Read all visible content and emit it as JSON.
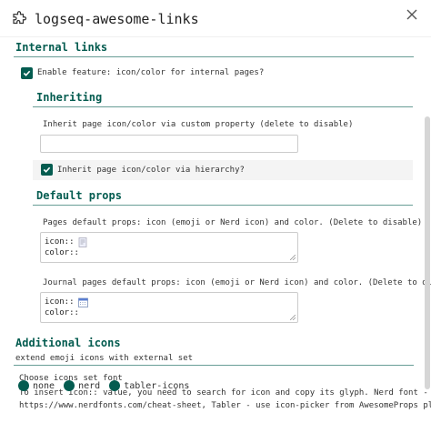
{
  "header": {
    "title": "logseq-awesome-links"
  },
  "internal_links": {
    "title": "Internal links",
    "enable_label": "Enable feature: icon/color for internal pages?",
    "enable_checked": true,
    "inheriting": {
      "title": "Inheriting",
      "custom_prop_label": "Inherit page icon/color via custom property (delete to disable)",
      "custom_prop_value": "",
      "hierarchy_label": "Inherit page icon/color via hierarchy?",
      "hierarchy_checked": true
    },
    "default_props": {
      "title": "Default props",
      "pages_label": "Pages default props: icon (emoji or Nerd icon) and color. (Delete to disable)",
      "pages_value": {
        "icon_line": "icon::",
        "color_line": "color::"
      },
      "journal_label": "Journal pages default props: icon (emoji or Nerd icon) and color. (Delete to disable)",
      "journal_value": {
        "icon_line": "icon::",
        "color_line": "color::"
      }
    }
  },
  "additional_icons": {
    "title": "Additional icons",
    "subtitle": "extend emoji icons with external set",
    "font_label": "Choose icons set font",
    "desc_line1": "To insert icon:: value, you need to search for icon and copy its glyph. Nerd font -",
    "desc_line2": "https://www.nerdfonts.com/cheat-sheet, Tabler - use icon-picker from AwesomeProps plugin",
    "options": [
      "none",
      "nerd",
      "tabler-icons"
    ]
  },
  "colors": {
    "accent": "#045c50"
  }
}
